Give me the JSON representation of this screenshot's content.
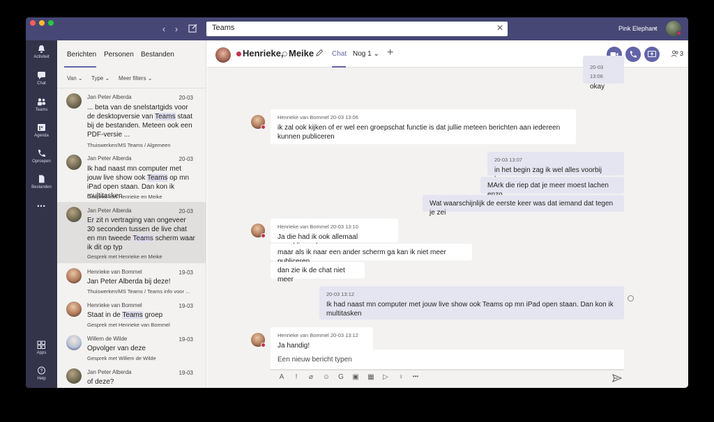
{
  "titlebar": {
    "back_glyph": "‹",
    "forward_glyph": "›",
    "search_value": "Teams",
    "search_clear_glyph": "✕",
    "user_name": "Pink Elephant",
    "user_chevron": "⌄"
  },
  "rail": {
    "items": [
      {
        "label": "Activiteit",
        "icon": "bell-icon"
      },
      {
        "label": "Chat",
        "icon": "chat-icon"
      },
      {
        "label": "Teams",
        "icon": "teams-icon"
      },
      {
        "label": "Agenda",
        "icon": "calendar-icon"
      },
      {
        "label": "Oproepen",
        "icon": "phone-icon"
      },
      {
        "label": "Bestanden",
        "icon": "file-icon"
      }
    ],
    "more_glyph": "•••",
    "apps_label": "Apps",
    "help_label": "Help"
  },
  "left": {
    "tabs": [
      {
        "label": "Berichten"
      },
      {
        "label": "Personen"
      },
      {
        "label": "Bestanden"
      }
    ],
    "filters": [
      {
        "label": "Van ⌄"
      },
      {
        "label": "Type ⌄"
      },
      {
        "label": "Meer filters ⌄"
      }
    ],
    "messages": [
      {
        "sender": "Jan Peter Alberda",
        "date": "20-03",
        "pre": "... beta van de snelstartgids voor de desktopversie van ",
        "hl": "Teams",
        "post": " staat bij de bestanden. Meteen ook een PDF-versie ...",
        "context": "Thuiswerken/MS Teams / Algemeen"
      },
      {
        "sender": "Jan Peter Alberda",
        "date": "20-03",
        "pre": "Ik had naast mn computer met jouw live show ook ",
        "hl": "Teams",
        "post": " op mn iPad open staan. Dan kon ik multitasken",
        "context": "Gesprek met Henrieke en Meike"
      },
      {
        "sender": "Jan Peter Alberda",
        "date": "20-03",
        "pre": "Er zit n vertraging van ongeveer 30 seconden tussen de live chat en mn tweede ",
        "hl": "Teams",
        "post": " scherm waar ik dit op typ",
        "context": "Gesprek met Henrieke en Meike"
      },
      {
        "sender": "Henrieke van Bommel",
        "date": "19-03",
        "pre": "Jan Peter Alberda bij deze!",
        "hl": "",
        "post": "",
        "context": "Thuiswerken/MS Teams / Teams info voor ..."
      },
      {
        "sender": "Henrieke van Bommel",
        "date": "19-03",
        "pre": "Staat in de ",
        "hl": "Teams",
        "post": " groep",
        "context": "Gesprek met Henrieke van Bommel"
      },
      {
        "sender": "Willem de Wilde",
        "date": "19-03",
        "pre": "Opvolger van deze",
        "hl": "",
        "post": "",
        "context": "Gesprek met Willem de Wilde"
      },
      {
        "sender": "Jan Peter Alberda",
        "date": "19-03",
        "pre": "of deze?",
        "hl": "",
        "post": "",
        "context": ""
      }
    ]
  },
  "chat": {
    "participants": [
      {
        "name": "Henrieke,"
      },
      {
        "name": "Meike"
      }
    ],
    "tab_chat": "Chat",
    "tab_more": "Nog 1 ⌄",
    "add_tab_glyph": "+",
    "people_count": "3",
    "messages": [
      {
        "meta": "20-03 13:06",
        "text": "okay",
        "mine": true
      },
      {
        "meta": "Henrieke van Bommel   20-03 13:06",
        "text": "ik zal ook kijken of er wel een groepschat functie is dat jullie meteen berichten aan iedereen kunnen publiceren",
        "mine": false
      },
      {
        "meta": "20-03 13:07",
        "text": "in het begin zag ik wel alles voorbij komen",
        "mine": true
      },
      {
        "meta": "",
        "text": "MArk die riep dat je meer moest lachen enzo",
        "mine": true
      },
      {
        "meta": "",
        "text": "Wat waarschijnlijk de eerste keer was dat iemand dat tegen je zei",
        "mine": true
      },
      {
        "meta": "Henrieke van Bommel   20-03 13:10",
        "text": "Ja die had ik ook allemaal gepubliceerd",
        "mine": false
      },
      {
        "meta": "",
        "text": "maar als ik naar een ander scherm ga kan ik niet meer publiceren",
        "mine": false
      },
      {
        "meta": "",
        "text": "dan zie ik de chat niet meer",
        "mine": false
      },
      {
        "meta": "20-03 13:12",
        "text": "Ik had naast mn computer met jouw live show ook Teams op mn iPad open staan. Dan kon ik multitasken",
        "mine": true
      },
      {
        "meta": "Henrieke van Bommel   20-03 13:12",
        "text": "Ja handig!",
        "mine": false
      }
    ],
    "composer_placeholder": "Een nieuw bericht typen",
    "tools": [
      {
        "glyph": "A",
        "icon": "format-icon"
      },
      {
        "glyph": "!",
        "icon": "important-icon"
      },
      {
        "glyph": "⌀",
        "icon": "attach-icon"
      },
      {
        "glyph": "☺",
        "icon": "emoji-icon"
      },
      {
        "glyph": "G",
        "icon": "gif-icon"
      },
      {
        "glyph": "▣",
        "icon": "sticker-icon"
      },
      {
        "glyph": "▦",
        "icon": "meeting-icon"
      },
      {
        "glyph": "▷",
        "icon": "stream-icon"
      },
      {
        "glyph": "♀",
        "icon": "praise-icon"
      },
      {
        "glyph": "•••",
        "icon": "more-icon"
      }
    ]
  }
}
